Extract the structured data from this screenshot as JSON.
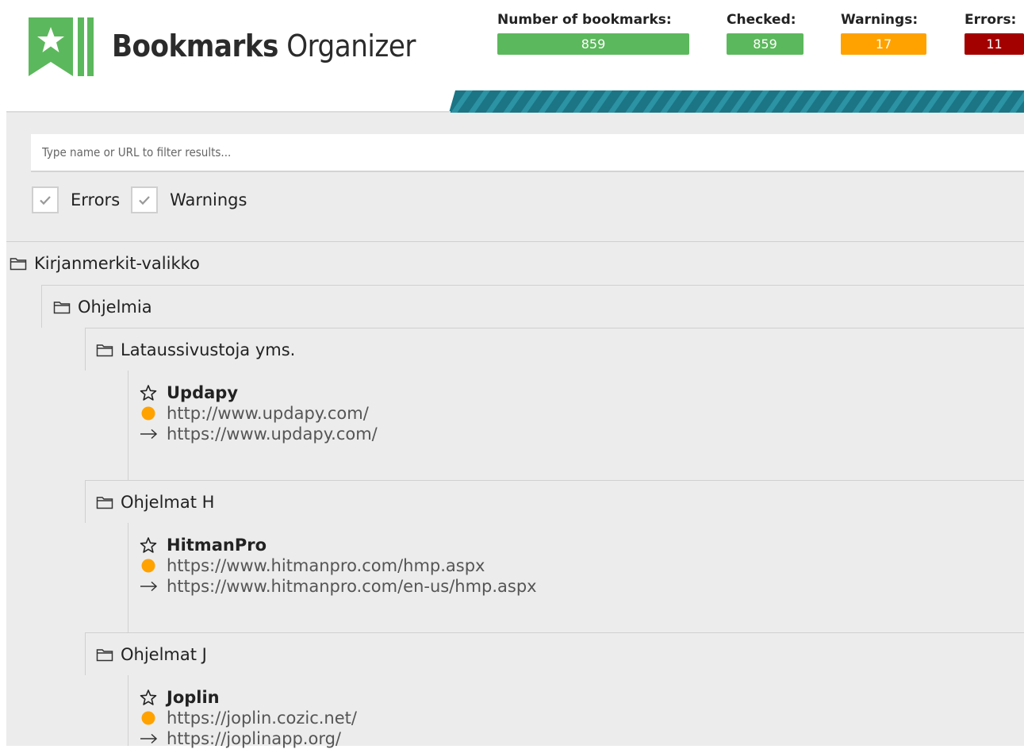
{
  "app": {
    "title_bold": "Bookmarks",
    "title_regular": "Organizer"
  },
  "stats": {
    "bookmarks": {
      "label": "Number of bookmarks:",
      "value": "859"
    },
    "checked": {
      "label": "Checked:",
      "value": "859"
    },
    "warnings": {
      "label": "Warnings:",
      "value": "17"
    },
    "errors": {
      "label": "Errors:",
      "value": "11"
    }
  },
  "colors": {
    "green": "#5cb85c",
    "orange": "#ffa200",
    "red": "#a30000",
    "band": "#1d7a8a"
  },
  "filter": {
    "placeholder": "Type name or URL to filter results...",
    "value": ""
  },
  "checks": {
    "errors_label": "Errors",
    "warnings_label": "Warnings",
    "errors_checked": true,
    "warnings_checked": true
  },
  "tree": {
    "root": {
      "label": "Kirjanmerkit-valikko",
      "icon": "folder-icon"
    },
    "sub": {
      "label": "Ohjelmia",
      "icon": "folder-icon"
    },
    "folders": [
      {
        "label": "Lataussivustoja yms.",
        "bookmark": {
          "title": "Updapy",
          "url": "http://www.updapy.com/",
          "redirect": "https://www.updapy.com/",
          "status": "warning"
        }
      },
      {
        "label": "Ohjelmat H",
        "bookmark": {
          "title": "HitmanPro",
          "url": "https://www.hitmanpro.com/hmp.aspx",
          "redirect": "https://www.hitmanpro.com/en-us/hmp.aspx",
          "status": "warning"
        }
      },
      {
        "label": "Ohjelmat J",
        "bookmark": {
          "title": "Joplin",
          "url": "https://joplin.cozic.net/",
          "redirect": "https://joplinapp.org/",
          "status": "warning"
        }
      }
    ]
  }
}
